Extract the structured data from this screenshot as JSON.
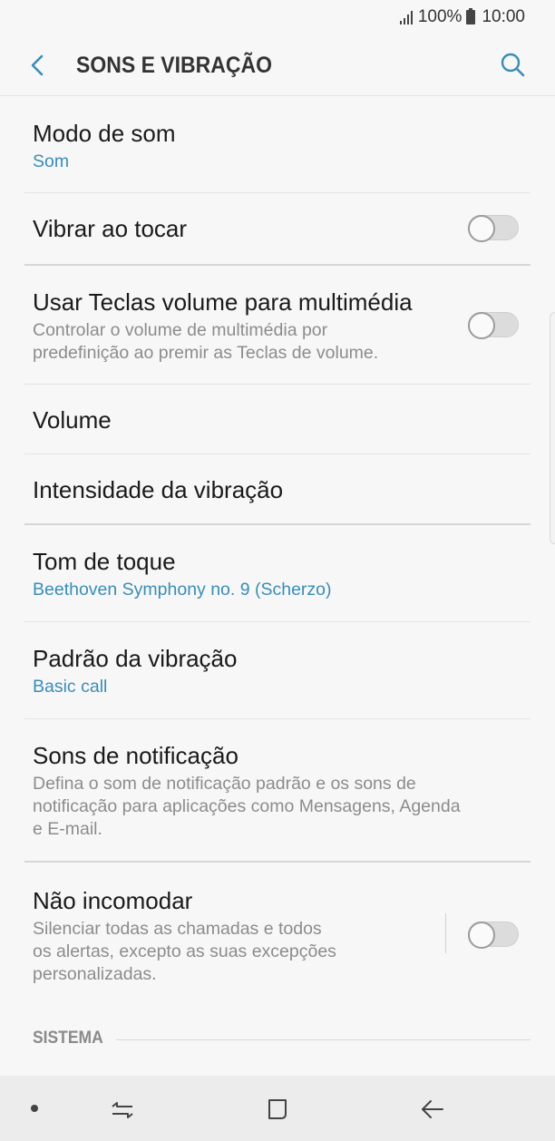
{
  "status_bar": {
    "battery_percent": "100%",
    "time": "10:00"
  },
  "header": {
    "title": "SONS E VIBRAÇÃO",
    "back_icon": "back-arrow-icon",
    "search_icon": "search-icon"
  },
  "settings": {
    "sound_mode": {
      "title": "Modo de som",
      "value": "Som"
    },
    "vibrate_on_ring": {
      "title": "Vibrar ao tocar",
      "enabled": false
    },
    "volume_keys_media": {
      "title": "Usar Teclas volume para multimédia",
      "description_line1": "Controlar o volume de multimédia por",
      "description_line2": "predefinição ao premir as Teclas de volume.",
      "enabled": false
    },
    "volume": {
      "title": "Volume"
    },
    "vibration_intensity": {
      "title": "Intensidade da vibração"
    },
    "ringtone": {
      "title": "Tom de toque",
      "value": "Beethoven Symphony no. 9 (Scherzo)"
    },
    "vibration_pattern": {
      "title": "Padrão da vibração",
      "value": "Basic call"
    },
    "notification_sounds": {
      "title": "Sons de notificação",
      "description_line1": "Defina o som de notificação padrão e os sons de",
      "description_line2": "notificação para aplicações como Mensagens, Agenda",
      "description_line3": "e E-mail."
    },
    "do_not_disturb": {
      "title": "Não incomodar",
      "description_line1": "Silenciar todas as chamadas e todos",
      "description_line2": "os alertas, excepto as suas excepções",
      "description_line3": "personalizadas.",
      "enabled": false
    }
  },
  "section_system": {
    "label": "SISTEMA"
  },
  "nav_bar": {
    "icons": [
      "dot-icon",
      "recent-apps-icon",
      "home-icon",
      "back-icon"
    ]
  },
  "colors": {
    "accent": "#3a8db7",
    "background": "#f7f7f7",
    "nav_background": "#ececec"
  }
}
